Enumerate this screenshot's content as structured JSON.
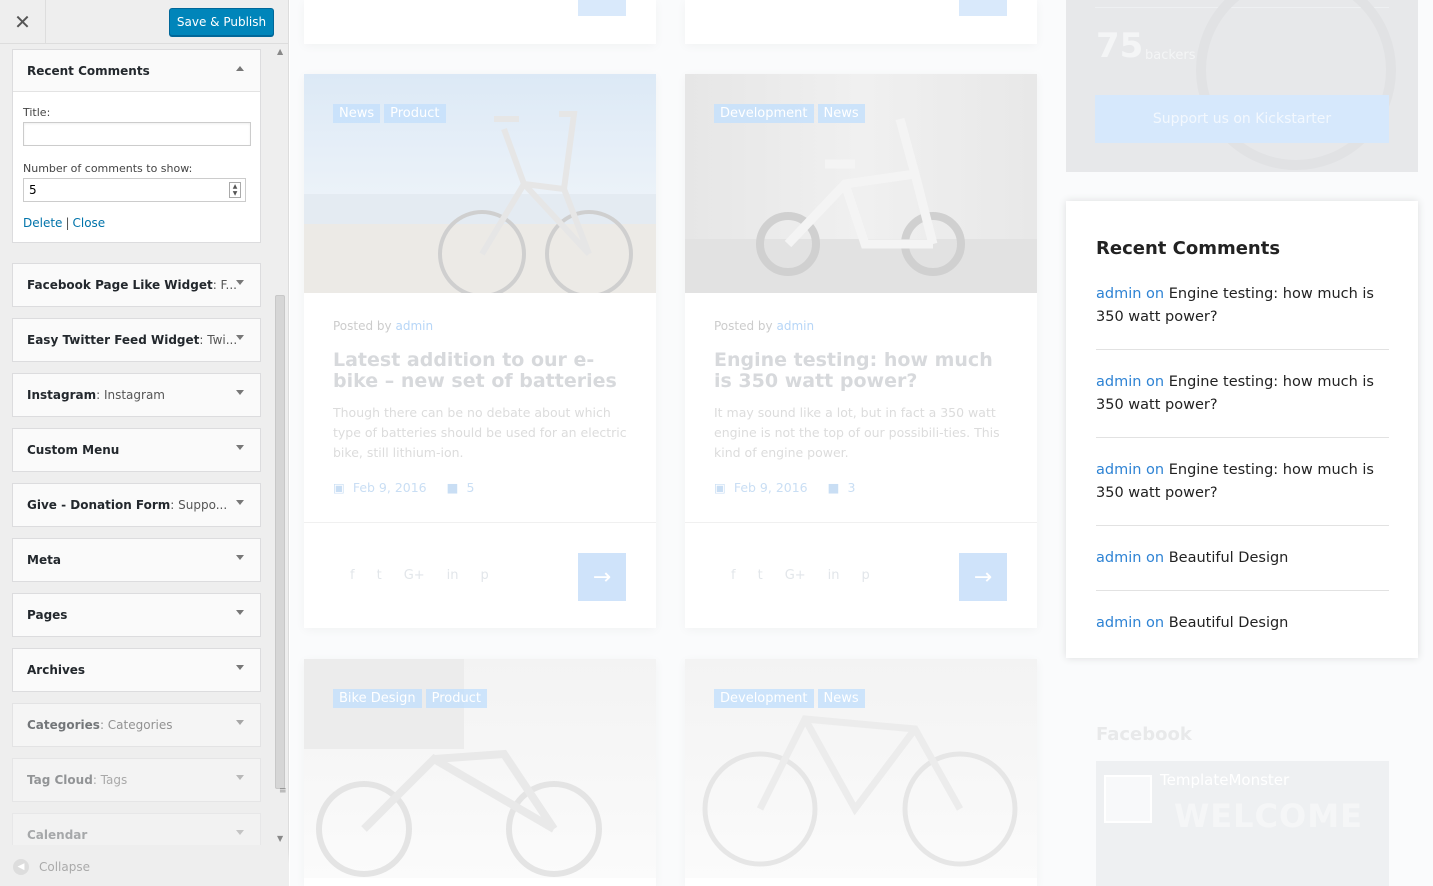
{
  "toolbar": {
    "close_glyph": "✕",
    "save_label": "Save & Publish"
  },
  "open_widget": {
    "title": "Recent Comments",
    "title_label": "Title:",
    "title_value": "",
    "count_label": "Number of comments to show:",
    "count_value": "5",
    "delete_label": "Delete",
    "separator": "|",
    "close_label": "Close"
  },
  "widgets": [
    {
      "name": "Facebook Page Like Widget",
      "sub": ": F..."
    },
    {
      "name": "Easy Twitter Feed Widget",
      "sub": ": Twi..."
    },
    {
      "name": "Instagram",
      "sub": ": Instagram"
    },
    {
      "name": "Custom Menu",
      "sub": ""
    },
    {
      "name": "Give - Donation Form",
      "sub": ": Suppo..."
    },
    {
      "name": "Meta",
      "sub": ""
    },
    {
      "name": "Pages",
      "sub": ""
    },
    {
      "name": "Archives",
      "sub": ""
    },
    {
      "name": "Categories",
      "sub": ": Categories"
    },
    {
      "name": "Tag Cloud",
      "sub": ": Tags"
    },
    {
      "name": "Calendar",
      "sub": ""
    }
  ],
  "collapse_label": "Collapse",
  "posts": [
    {
      "tags": [
        "News",
        "Product"
      ],
      "posted_by": "Posted by",
      "author": "admin",
      "title": "Latest addition to our e-bike – new set of batteries",
      "excerpt": "Though there can be no debate about which type of batteries should be used for an electric bike, still lithium-ion.",
      "date": "Feb 9, 2016",
      "comments": "5"
    },
    {
      "tags": [
        "Development",
        "News"
      ],
      "posted_by": "Posted by",
      "author": "admin",
      "title": "Engine testing: how much is 350 watt power?",
      "excerpt": "It may sound like a lot, but in fact a 350 watt engine is not the top of our possibili-ties. This kind of engine power.",
      "date": "Feb 9, 2016",
      "comments": "3"
    },
    {
      "tags": [
        "Bike Design",
        "Product"
      ]
    },
    {
      "tags": [
        "Development",
        "News"
      ]
    }
  ],
  "social_icons": [
    "f",
    "t",
    "G+",
    "in",
    "p"
  ],
  "kickstarter": {
    "backers_count": "75",
    "backers_label": "backers",
    "button": "Support us on Kickstarter"
  },
  "recent_comments": {
    "title": "Recent Comments",
    "items": [
      {
        "author": "admin",
        "on": "on",
        "post": "Engine testing: how much is 350 watt power?"
      },
      {
        "author": "admin",
        "on": "on",
        "post": "Engine testing: how much is 350 watt power?"
      },
      {
        "author": "admin",
        "on": "on",
        "post": "Engine testing: how much is 350 watt power?"
      },
      {
        "author": "admin",
        "on": "on",
        "post": "Beautiful Design"
      },
      {
        "author": "admin",
        "on": "on",
        "post": "Beautiful Design"
      }
    ]
  },
  "facebook": {
    "title": "Facebook",
    "page_name": "TemplateMonster",
    "banner": "WELCOME"
  },
  "colors": {
    "accent": "#0085ba",
    "link": "#0073aa",
    "comment_author": "#2e83d4"
  }
}
